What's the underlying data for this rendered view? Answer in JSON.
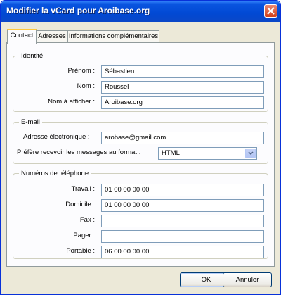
{
  "window": {
    "title": "Modifier la vCard pour Aroibase.org"
  },
  "tabs": [
    {
      "label": "Contact",
      "active": true
    },
    {
      "label": "Adresses",
      "active": false
    },
    {
      "label": "Informations complémentaires",
      "active": false
    }
  ],
  "identity": {
    "group_title": "Identité",
    "first_name_label": "Prénom :",
    "first_name_value": "Sébastien",
    "last_name_label": "Nom :",
    "last_name_value": "Roussel",
    "display_name_label": "Nom à afficher :",
    "display_name_value": "Aroibase.org"
  },
  "email": {
    "group_title": "E-mail",
    "address_label": "Adresse électronique :",
    "address_value": "arobase@gmail.com",
    "format_label": "Préfère recevoir les messages au format :",
    "format_value": "HTML"
  },
  "phones": {
    "group_title": "Numéros de téléphone",
    "work_label": "Travail :",
    "work_value": "01 00 00 00 00",
    "home_label": "Domicile :",
    "home_value": "01 00 00 00 00",
    "fax_label": "Fax :",
    "fax_value": "",
    "pager_label": "Pager :",
    "pager_value": "",
    "mobile_label": "Portable :",
    "mobile_value": "06 00 00 00 00"
  },
  "buttons": {
    "ok": "OK",
    "cancel": "Annuler"
  },
  "icons": {
    "close": "close-icon",
    "dropdown": "chevron-down-icon"
  },
  "colors": {
    "titlebar": "#0149d4",
    "dialog": "#ece9d8",
    "active_tab_accent": "#ffc83c",
    "close_button": "#d2411a"
  }
}
